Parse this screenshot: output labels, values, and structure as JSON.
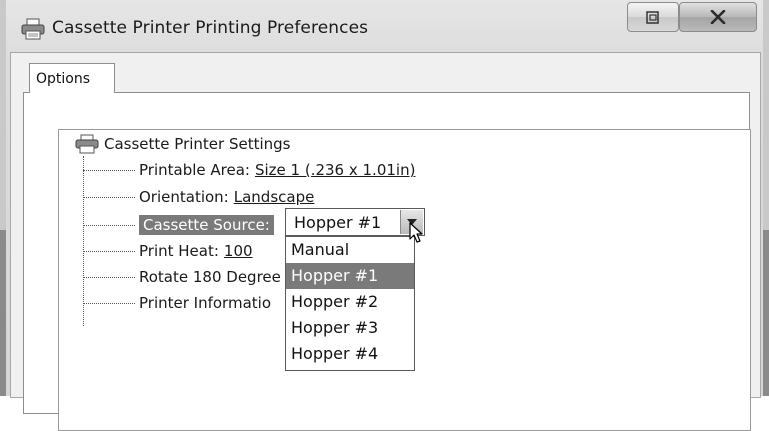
{
  "window": {
    "title": "Cassette Printer Printing Preferences"
  },
  "tabs": [
    {
      "label": "Options"
    }
  ],
  "tree": {
    "root_label": "Cassette Printer Settings",
    "items": [
      {
        "label": "Printable Area:",
        "value": "Size 1 (.236 x 1.01in)"
      },
      {
        "label": "Orientation:",
        "value": "Landscape"
      },
      {
        "label": "Cassette Source:",
        "value": ""
      },
      {
        "label": "Print Heat:",
        "value": "100"
      },
      {
        "label": "Rotate 180 Degree",
        "value": ""
      },
      {
        "label": "Printer Informatio",
        "value": ""
      }
    ]
  },
  "combo": {
    "selected": "Hopper #1",
    "options": [
      "Manual",
      "Hopper #1",
      "Hopper #2",
      "Hopper #3",
      "Hopper #4"
    ],
    "highlighted_index": 1
  }
}
